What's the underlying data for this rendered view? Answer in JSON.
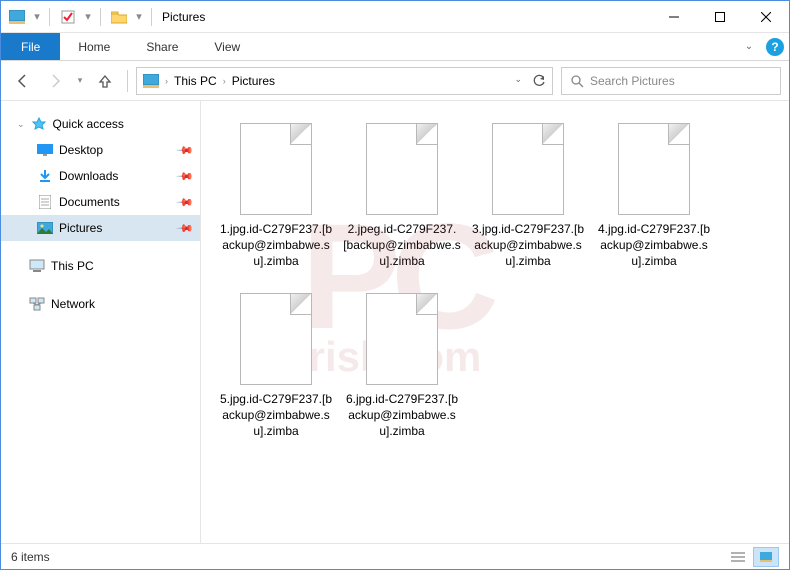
{
  "window": {
    "title": "Pictures"
  },
  "ribbon": {
    "file": "File",
    "tabs": [
      "Home",
      "Share",
      "View"
    ]
  },
  "nav": {
    "breadcrumbs": [
      "This PC",
      "Pictures"
    ],
    "search_placeholder": "Search Pictures"
  },
  "sidebar": {
    "quick_access": "Quick access",
    "items": [
      {
        "label": "Desktop",
        "icon": "desktop"
      },
      {
        "label": "Downloads",
        "icon": "downloads"
      },
      {
        "label": "Documents",
        "icon": "documents"
      },
      {
        "label": "Pictures",
        "icon": "pictures",
        "selected": true
      }
    ],
    "this_pc": "This PC",
    "network": "Network"
  },
  "files": [
    {
      "name": "1.jpg.id-C279F237.[backup@zimbabwe.su].zimba"
    },
    {
      "name": "2.jpeg.id-C279F237.[backup@zimbabwe.su].zimba"
    },
    {
      "name": "3.jpg.id-C279F237.[backup@zimbabwe.su].zimba"
    },
    {
      "name": "4.jpg.id-C279F237.[backup@zimbabwe.su].zimba"
    },
    {
      "name": "5.jpg.id-C279F237.[backup@zimbabwe.su].zimba"
    },
    {
      "name": "6.jpg.id-C279F237.[backup@zimbabwe.su].zimba"
    }
  ],
  "status": {
    "count": "6 items"
  }
}
